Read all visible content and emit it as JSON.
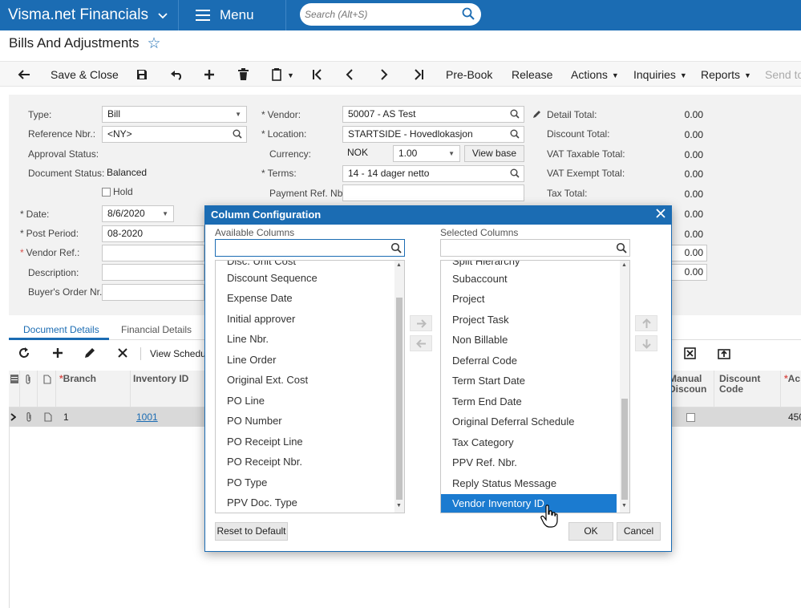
{
  "app": {
    "name": "Visma.net Financials",
    "menu_label": "Menu",
    "search_placeholder": "Search (Alt+S)"
  },
  "page": {
    "title": "Bills And Adjustments"
  },
  "toolbar": {
    "save_close": "Save & Close",
    "pre_book": "Pre-Book",
    "release": "Release",
    "actions": "Actions",
    "inquiries": "Inquiries",
    "reports": "Reports",
    "send_to": "Send to"
  },
  "form": {
    "type_label": "Type:",
    "type_value": "Bill",
    "ref_label": "Reference Nbr.:",
    "ref_value": "<NY>",
    "approval_label": "Approval Status:",
    "docstatus_label": "Document Status:",
    "docstatus_value": "Balanced",
    "hold_label": "Hold",
    "date_label": "Date:",
    "date_value": "8/6/2020",
    "period_label": "Post Period:",
    "period_value": "08-2020",
    "vendorref_label": "Vendor Ref.:",
    "description_label": "Description:",
    "buyer_label": "Buyer's Order Nr.:",
    "vendor_label": "Vendor:",
    "vendor_value": "50007 - AS Test",
    "location_label": "Location:",
    "location_value": "STARTSIDE - Hovedlokasjon",
    "currency_label": "Currency:",
    "currency_value": "NOK",
    "rate_value": "1.00",
    "view_base": "View base",
    "terms_label": "Terms:",
    "terms_value": "14 - 14 dager netto",
    "payref_label": "Payment Ref. Nbr:",
    "detail_total_label": "Detail Total:",
    "detail_total": "0.00",
    "discount_total_label": "Discount Total:",
    "discount_total": "0.00",
    "vat_taxable_label": "VAT Taxable Total:",
    "vat_taxable": "0.00",
    "vat_exempt_label": "VAT Exempt Total:",
    "vat_exempt": "0.00",
    "tax_total_label": "Tax Total:",
    "tax_total": "0.00",
    "extra_values": [
      "0.00",
      "0.00",
      "0.00",
      "0.00"
    ]
  },
  "tabs": {
    "document_details": "Document Details",
    "financial_details": "Financial Details"
  },
  "grid": {
    "view_schedule": "View Schedule",
    "headers": {
      "branch": "Branch",
      "inventory": "Inventory ID",
      "manual_discount_1": "Manual",
      "manual_discount_2": "Discoun",
      "discount_code_1": "Discount",
      "discount_code_2": "Code",
      "ac": "Ac"
    },
    "row": {
      "branch": "1",
      "inventory": "1001",
      "amount": "450"
    }
  },
  "modal": {
    "title": "Column Configuration",
    "available_label": "Available Columns",
    "selected_label": "Selected Columns",
    "available": [
      "Disc. Unit Cost",
      "Discount Sequence",
      "Expense Date",
      "Initial approver",
      "Line Nbr.",
      "Line Order",
      "Original Ext. Cost",
      "PO Line",
      "PO Number",
      "PO Receipt Line",
      "PO Receipt Nbr.",
      "PO Type",
      "PPV Doc. Type"
    ],
    "selected": [
      "Split Hierarchy",
      "Subaccount",
      "Project",
      "Project Task",
      "Non Billable",
      "Deferral Code",
      "Term Start Date",
      "Term End Date",
      "Original Deferral Schedule",
      "Tax Category",
      "PPV Ref. Nbr.",
      "Reply Status Message",
      "Vendor Inventory ID"
    ],
    "reset": "Reset to Default",
    "ok": "OK",
    "cancel": "Cancel"
  },
  "colors": {
    "brand": "#1b6cb3",
    "selection": "#1b7bd0",
    "required": "#d9534f"
  }
}
